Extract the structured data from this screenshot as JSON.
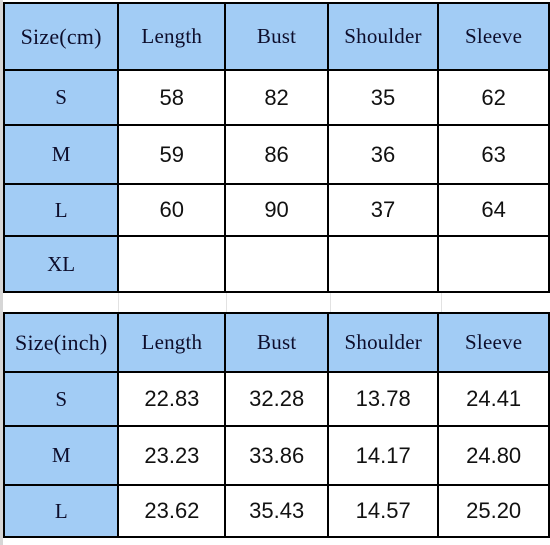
{
  "tables": [
    {
      "id": "cm",
      "unit_header": "Size(cm)",
      "columns": [
        "Length",
        "Bust",
        "Shoulder",
        "Sleeve"
      ],
      "rows": [
        {
          "size": "S",
          "values": [
            "58",
            "82",
            "35",
            "62"
          ]
        },
        {
          "size": "M",
          "values": [
            "59",
            "86",
            "36",
            "63"
          ]
        },
        {
          "size": "L",
          "values": [
            "60",
            "90",
            "37",
            "64"
          ]
        },
        {
          "size": "XL",
          "values": [
            "",
            "",
            "",
            ""
          ]
        }
      ]
    },
    {
      "id": "inch",
      "unit_header": "Size(inch)",
      "columns": [
        "Length",
        "Bust",
        "Shoulder",
        "Sleeve"
      ],
      "rows": [
        {
          "size": "S",
          "values": [
            "22.83",
            "32.28",
            "13.78",
            "24.41"
          ]
        },
        {
          "size": "M",
          "values": [
            "23.23",
            "33.86",
            "14.17",
            "24.80"
          ]
        },
        {
          "size": "L",
          "values": [
            "23.62",
            "35.43",
            "14.57",
            "25.20"
          ]
        }
      ]
    }
  ],
  "colors": {
    "header_blue": "#a2ccf5",
    "grid_line": "#000000",
    "text": "#0d0d2b",
    "value_text": "#111111",
    "background": "#ffffff"
  }
}
